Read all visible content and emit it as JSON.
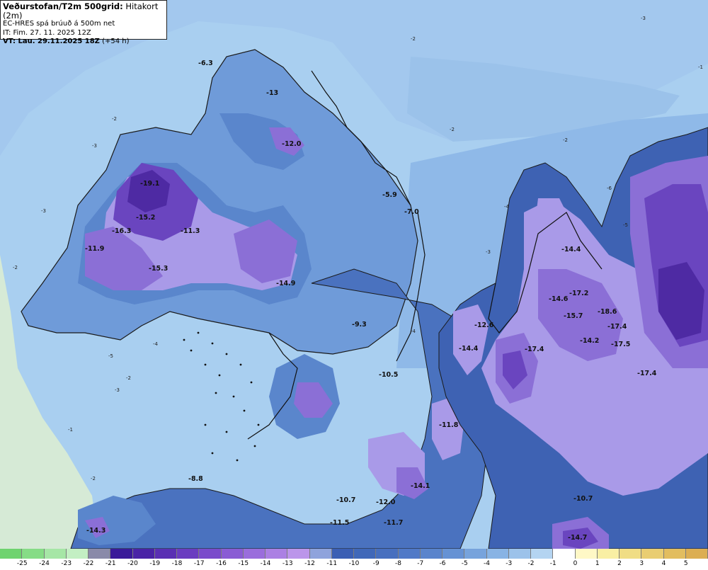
{
  "header": {
    "line1_bold": "Veðurstofan/T2m 500grid:",
    "line1_rest": " Hitakort (2m)",
    "line2": "EC-HRES spá brúuð á 500m net",
    "line3": "IT: Fim. 27. 11. 2025 12Z",
    "line4_bold": "VT: Lau. 29.11.2025 18Z",
    "line4_rest": " (+54 h)"
  },
  "colors": {
    "sea": "#a9cff0",
    "land_green": "#d6ead6",
    "lvl_m2": "#8fb9e8",
    "lvl_m4": "#6f9bd9",
    "lvl_m6": "#5a86cc",
    "lvl_m8": "#4a72bf",
    "lvl_m10": "#3e62b3",
    "lvl_m12": "#a99ae8",
    "lvl_m14": "#8b6fd6",
    "lvl_m16": "#6a45bf",
    "lvl_m18": "#4e2aa3"
  },
  "temperature_labels": [
    {
      "text": "-12.0"
    },
    {
      "text": "-19.1"
    },
    {
      "text": "-15.2"
    },
    {
      "text": "-16.3"
    },
    {
      "text": "-11.3"
    },
    {
      "text": "-11.9"
    },
    {
      "text": "-15.3"
    },
    {
      "text": "-14.9"
    },
    {
      "text": "-5.9"
    },
    {
      "text": "-7.0"
    },
    {
      "text": "-9.3"
    },
    {
      "text": "-10.5"
    },
    {
      "text": "-12.6"
    },
    {
      "text": "-14.4"
    },
    {
      "text": "-17.4"
    },
    {
      "text": "-14.4"
    },
    {
      "text": "-14.6"
    },
    {
      "text": "-17.2"
    },
    {
      "text": "-15.7"
    },
    {
      "text": "-18.6"
    },
    {
      "text": "-17.4"
    },
    {
      "text": "-14.2"
    },
    {
      "text": "-17.5"
    },
    {
      "text": "-17.4"
    },
    {
      "text": "-11.8"
    },
    {
      "text": "-14.1"
    },
    {
      "text": "-8.8"
    },
    {
      "text": "-10.7"
    },
    {
      "text": "-12.0"
    },
    {
      "text": "-11.5"
    },
    {
      "text": "-11.7"
    },
    {
      "text": "-14.3"
    },
    {
      "text": "-10.7"
    },
    {
      "text": "-14.7"
    },
    {
      "text": "-6.3"
    },
    {
      "text": "-13"
    }
  ],
  "isoline_labels": [
    "-2",
    "-3",
    "-2",
    "-2",
    "-3",
    "-4",
    "-5",
    "-6",
    "-4",
    "-5",
    "-3",
    "-2",
    "-1",
    "-2",
    "-3",
    "-4",
    "-2",
    "-3",
    "-2",
    "-1"
  ],
  "colorbar": {
    "ticks": [
      "-25",
      "-24",
      "-23",
      "-22",
      "-21",
      "-20",
      "-19",
      "-18",
      "-17",
      "-16",
      "-15",
      "-14",
      "-13",
      "-12",
      "-11",
      "-10",
      "-9",
      "-8",
      "-7",
      "-6",
      "-5",
      "-4",
      "-3",
      "-2",
      "-1",
      "0",
      "1",
      "2",
      "3",
      "4",
      "5"
    ],
    "cell_colors": [
      "#6fd36f",
      "#86dc86",
      "#a6e6a6",
      "#c3efc3",
      "#8a8aa9",
      "#3a1a99",
      "#4a23a6",
      "#5a2fb3",
      "#6a3cc0",
      "#7a4bcb",
      "#8a5cd4",
      "#9a6ddc",
      "#ab80e3",
      "#bb95ea",
      "#8fa3dc",
      "#3b5fb4",
      "#4068b9",
      "#476fbf",
      "#5079c7",
      "#5a84cc",
      "#6692d4",
      "#77a3dc",
      "#88b3e4",
      "#9cc2ea",
      "#b4d4f1",
      "#ffffff",
      "#fff8c6",
      "#f9efa4",
      "#f0dd85",
      "#e9cd72",
      "#e2bd5f",
      "#dcae52"
    ]
  }
}
